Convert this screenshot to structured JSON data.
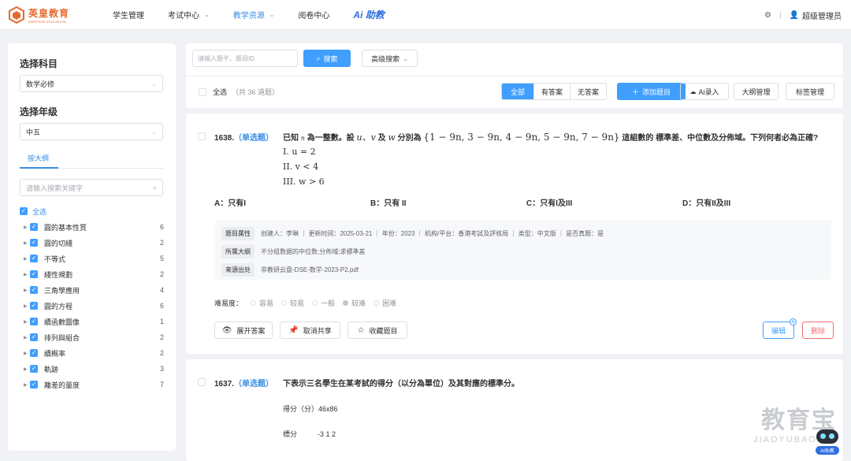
{
  "brand": {
    "name": "英皇教育",
    "tagline": "EMPEROR EDUCATION",
    "color": "#e66a2c"
  },
  "nav": {
    "items": [
      {
        "label": "学生管理"
      },
      {
        "label": "考试中心"
      },
      {
        "label": "教学资源"
      },
      {
        "label": "阅卷中心"
      }
    ],
    "ai_label": "Ai 助教",
    "active": "教学资源"
  },
  "user": {
    "name": "超级管理员"
  },
  "sidebar": {
    "subject_title": "选择科目",
    "subject_value": "数学必修",
    "grade_title": "选择年级",
    "grade_value": "中五",
    "tab_label": "按大纲",
    "search_placeholder": "请输入搜索关键字",
    "all_label": "全选",
    "items": [
      {
        "label": "圓的基本性質",
        "count": "6"
      },
      {
        "label": "圓的切綫",
        "count": "2"
      },
      {
        "label": "不等式",
        "count": "5"
      },
      {
        "label": "綫性規劃",
        "count": "2"
      },
      {
        "label": "三角學應用",
        "count": "4"
      },
      {
        "label": "圓的方程",
        "count": "6"
      },
      {
        "label": "續函數圖像",
        "count": "1"
      },
      {
        "label": "排列與組合",
        "count": "2"
      },
      {
        "label": "續概率",
        "count": "2"
      },
      {
        "label": "軌跡",
        "count": "3"
      },
      {
        "label": "離差的量度",
        "count": "7"
      }
    ]
  },
  "toolbar": {
    "search_placeholder": "请输入题干、题目ID",
    "search_button": "搜索",
    "advanced_search": "高级搜索",
    "select_all": "全选",
    "total": "（共 36 道题）",
    "filters": [
      "全部",
      "有答案",
      "无答案"
    ],
    "add_button": "添加题目",
    "ai_import": "Ai录入",
    "outline_manage": "大纲管理",
    "tag_manage": "标签管理"
  },
  "questions": [
    {
      "number": "1638.",
      "type": "（单选题）",
      "stem_prefix": "已知",
      "stem_n": "n",
      "stem_mid": "為一整數。設",
      "stem_vars": "u、v",
      "stem_and": "及",
      "stem_w": "w",
      "stem_each": "分別為",
      "stem_set": "{1 − 9n, 3 − 9n, 4 − 9n, 5 − 9n, 7 − 9n}",
      "stem_suffix": "這組數的 標準差、中位數及分佈域。下列何者必為正確?",
      "conditions": [
        "I. u = 2",
        "II. v < 4",
        "III. w > 6"
      ],
      "options": [
        "A：只有I",
        "B：只有 II",
        "C：只有I及III",
        "D：只有II及III"
      ],
      "meta": {
        "attr_tag": "题目属性",
        "attr_value": "创建人：李琳 ｜ 更新时间：2025-03-21 ｜ 年份：2023 ｜ 机构/平台：香港考試及評核局 ｜ 类型：中文版 ｜ 是否真题：是",
        "outline_tag": "所属大纲",
        "outline_value": "不分组数据的中位数;分佈域;求標準差",
        "source_tag": "来源出处",
        "source_value": "非教研云盘-DSE-数学-2023-P2.pdf"
      },
      "difficulty_label": "难易度：",
      "difficulty_levels": [
        "容易",
        "较易",
        "一般",
        "较难",
        "困难"
      ],
      "difficulty_selected": "较难",
      "actions": {
        "expand": "展开答案",
        "unshare": "取消共享",
        "favorite": "收藏题目",
        "edit": "编辑",
        "delete": "删除"
      }
    },
    {
      "number": "1637.",
      "type": "（单选题）",
      "stem": "下表示三名學生在某考試的得分（以分為單位）及其對應的標準分。",
      "row1": "得分（分）46x86",
      "row2_label": "標分",
      "row2_value": "-3 1 2"
    }
  ],
  "watermark": {
    "cn": "教育宝",
    "en": "JIAOYUBAO.CN",
    "bot_label": "AI助教"
  }
}
